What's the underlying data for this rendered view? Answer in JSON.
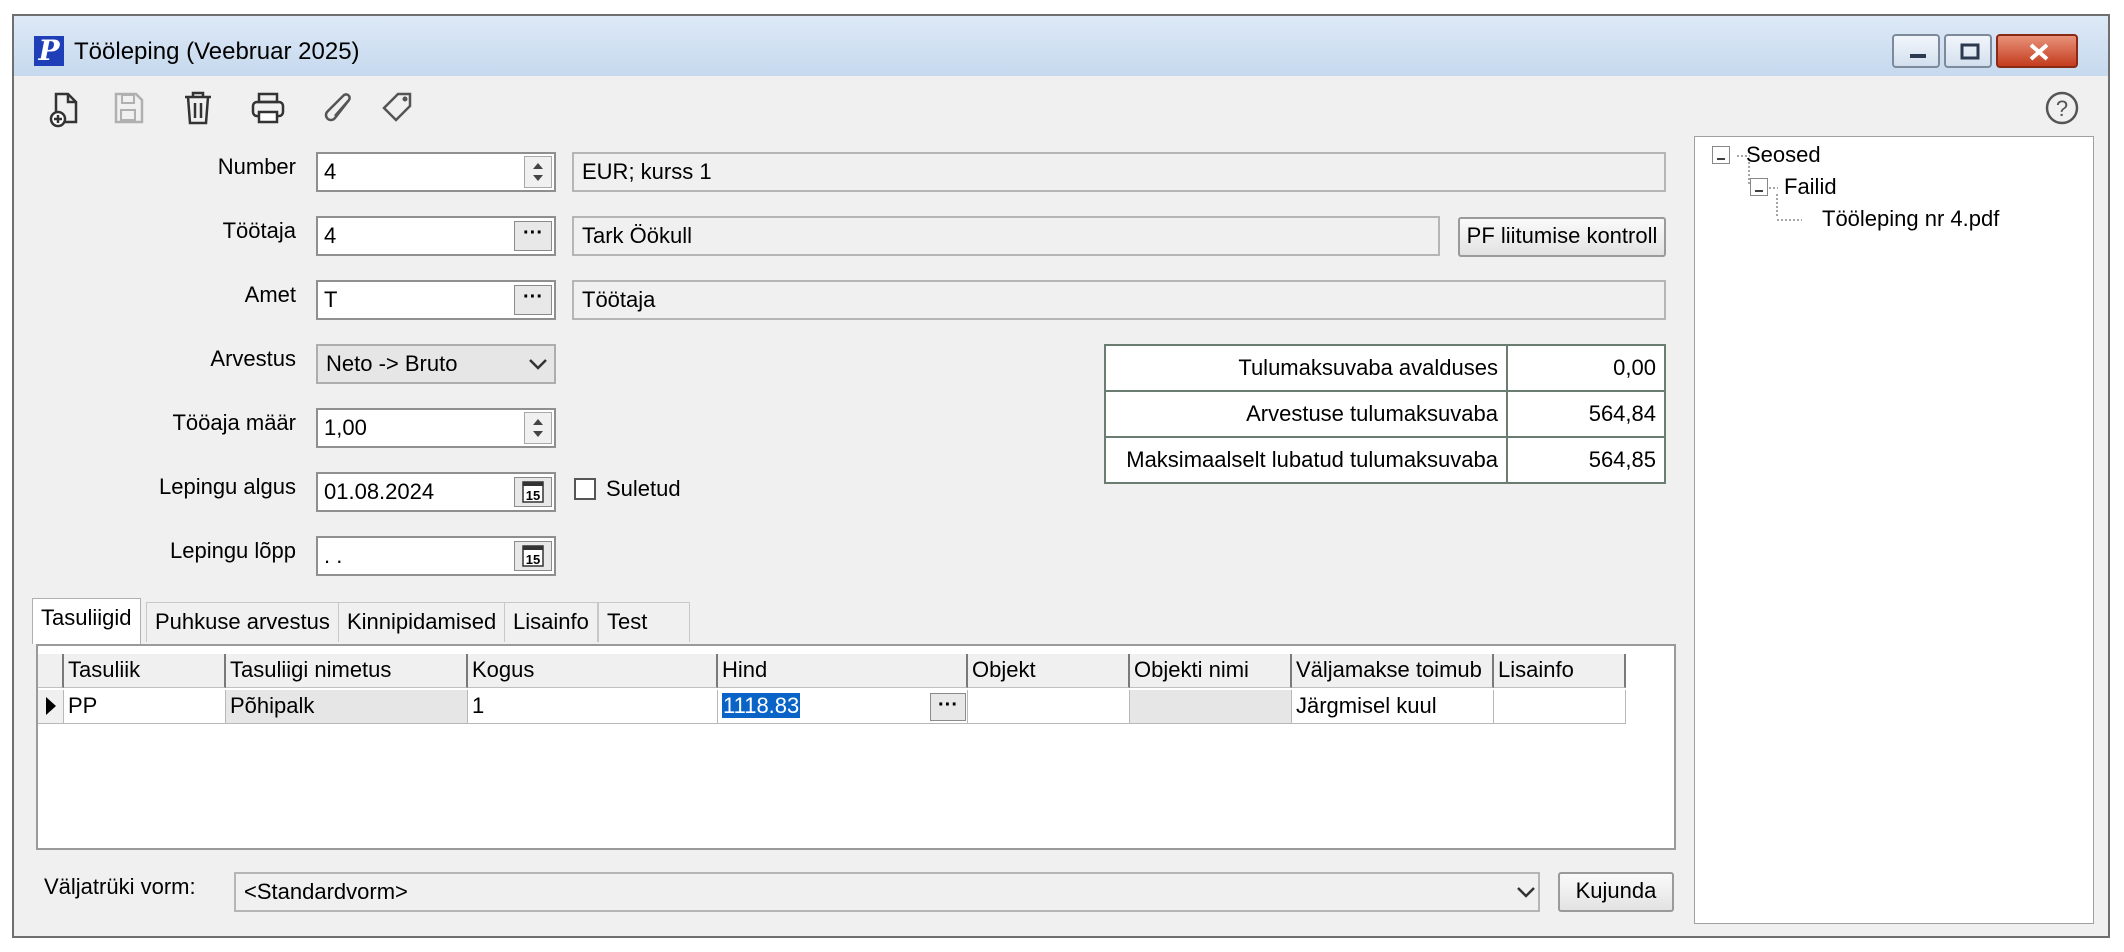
{
  "window": {
    "title": "Tööleping (Veebruar 2025)",
    "app_icon_letter": "P",
    "controls": [
      "minimize-icon",
      "restore-icon",
      "close-icon"
    ]
  },
  "toolbar": {
    "icons": [
      "new-document-icon",
      "save-icon",
      "delete-icon",
      "print-icon",
      "attach-icon",
      "tag-icon"
    ],
    "help_icon": "help-icon"
  },
  "form": {
    "number": {
      "label": "Number",
      "value": "4",
      "currency": "EUR; kurss 1"
    },
    "employee": {
      "label": "Töötaja",
      "value": "4",
      "name": "Tark Öökull",
      "pf_button": "PF liitumise kontroll"
    },
    "position": {
      "label": "Amet",
      "value": "T",
      "name": "Töötaja"
    },
    "calculation": {
      "label": "Arvestus",
      "value": "Neto -> Bruto"
    },
    "workload": {
      "label": "Tööaja määr",
      "value": "1,00"
    },
    "contract_start": {
      "label": "Lepingu algus",
      "value": "01.08.2024",
      "calendar_label": "15"
    },
    "contract_end": {
      "label": "Lepingu lõpp",
      "value": " .  .",
      "calendar_label": "15"
    },
    "closed": {
      "label": "Suletud",
      "checked": false
    }
  },
  "tax_table": [
    {
      "label": "Tulumaksuvaba avalduses",
      "value": "0,00"
    },
    {
      "label": "Arvestuse tulumaksuvaba",
      "value": "564,84"
    },
    {
      "label": "Maksimaalselt lubatud tulumaksuvaba",
      "value": "564,85"
    }
  ],
  "tabs": [
    "Tasuliigid",
    "Puhkuse arvestus",
    "Kinnipidamised",
    "Lisainfo",
    "Test"
  ],
  "active_tab": "Tasuliigid",
  "grid": {
    "columns": [
      "Tasuliik",
      "Tasuliigi nimetus",
      "Kogus",
      "Hind",
      "Objekt",
      "Objekti nimi",
      "Väljamakse toimub",
      "Lisainfo"
    ],
    "rows": [
      {
        "tasuliik": "PP",
        "nimetus": "Põhipalk",
        "kogus": "1",
        "hind": "1118.83",
        "objekt": "",
        "objekti_nimi": "",
        "valjamakse": "Järgmisel kuul",
        "lisainfo": ""
      }
    ]
  },
  "footer": {
    "print_form_label": "Väljatrüki vorm:",
    "print_form_value": "<Standardvorm>",
    "design_button": "Kujunda"
  },
  "tree": {
    "root": "Seosed",
    "child": "Failid",
    "leaf": "Tööleping nr 4.pdf"
  }
}
